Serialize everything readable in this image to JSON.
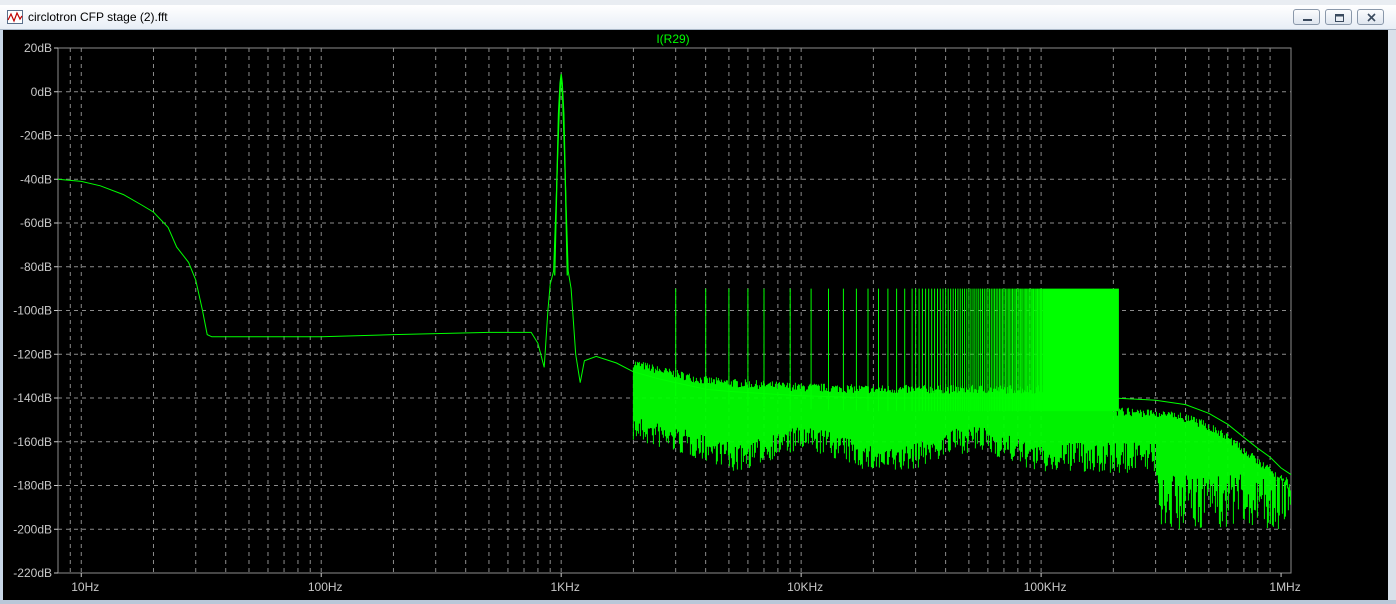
{
  "window": {
    "title": "circlotron CFP stage (2).fft",
    "minimize_icon": "minimize-icon",
    "restore_icon": "restore-icon",
    "close_icon": "close-icon"
  },
  "colors": {
    "background": "#000000",
    "grid": "#8c8c8c",
    "trace": "#00ff00",
    "tick_text": "#c8c8c8"
  },
  "chart_data": {
    "type": "line",
    "title": "I(R29)",
    "x_scale": "log",
    "x_unit": "Hz",
    "xlim": [
      8,
      1100000
    ],
    "ylim": [
      -220,
      20
    ],
    "y_ticks": [
      20,
      0,
      -20,
      -40,
      -60,
      -80,
      -100,
      -120,
      -140,
      -160,
      -180,
      -200,
      -220
    ],
    "y_tick_labels": [
      "20dB",
      "0dB",
      "-20dB",
      "-40dB",
      "-60dB",
      "-80dB",
      "-100dB",
      "-120dB",
      "-140dB",
      "-160dB",
      "-180dB",
      "-200dB",
      "-220dB"
    ],
    "x_ticks": [
      10,
      100,
      1000,
      10000,
      100000,
      1000000
    ],
    "x_tick_labels": [
      "10Hz",
      "100Hz",
      "1KHz",
      "10KHz",
      "100KHz",
      "1MHz"
    ],
    "grid": true,
    "series": [
      {
        "name": "I(R29)",
        "x": [
          8,
          10,
          12,
          15,
          18,
          20,
          23,
          25,
          28,
          30,
          32,
          33.5,
          35,
          50,
          100,
          200,
          500,
          750,
          800,
          850,
          880,
          900,
          930,
          960,
          985,
          1000,
          1015,
          1040,
          1070,
          1100,
          1150,
          1200,
          1250,
          1400,
          1700,
          2000,
          2500,
          3000,
          4000,
          5000,
          7000,
          10000,
          20000,
          50000,
          100000,
          200000,
          300000,
          400000,
          500000,
          600000,
          700000,
          800000,
          900000,
          1000000,
          1100000
        ],
        "y": [
          -40,
          -41,
          -43,
          -47,
          -52,
          -55,
          -62,
          -71,
          -78,
          -86,
          -100,
          -111,
          -112,
          -112,
          -112,
          -111,
          -110,
          -110,
          -115,
          -126,
          -100,
          -88,
          -82,
          -40,
          -5,
          8,
          -5,
          -40,
          -82,
          -90,
          -120,
          -133,
          -123,
          -121,
          -124,
          -128,
          -131,
          -133,
          -136,
          -137,
          -138,
          -139,
          -140,
          -140,
          -140,
          -140,
          -141,
          -143,
          -147,
          -152,
          -158,
          -163,
          -167,
          -172,
          -175
        ]
      }
    ],
    "harmonic_spur_floor_db": -90,
    "harmonic_spurs_from_hz": 2000,
    "harmonic_spurs_to_hz": 210000,
    "noise_floor_lower_db": [
      -160,
      -172,
      -200
    ]
  }
}
